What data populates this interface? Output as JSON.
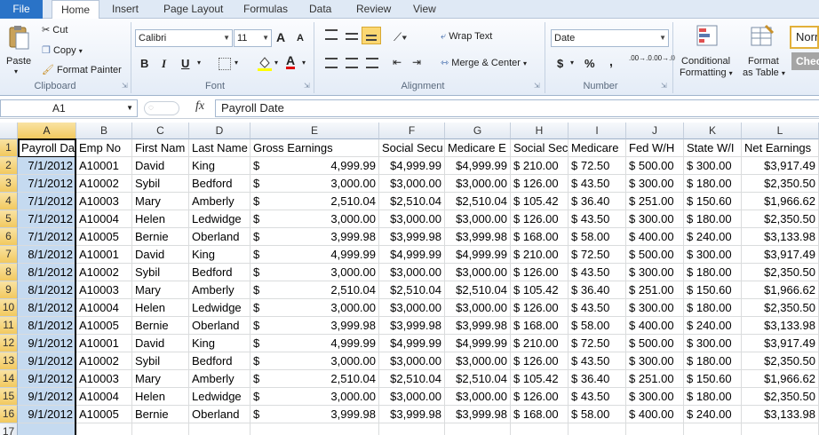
{
  "tabs": {
    "file": "File",
    "items": [
      "Home",
      "Insert",
      "Page Layout",
      "Formulas",
      "Data",
      "Review",
      "View"
    ],
    "active": "Home"
  },
  "clipboard": {
    "paste": "Paste",
    "cut": "Cut",
    "copy": "Copy",
    "format_painter": "Format Painter",
    "label": "Clipboard"
  },
  "font": {
    "name": "Calibri",
    "size": "11",
    "label": "Font",
    "bold": "B",
    "italic": "I",
    "underline": "U",
    "grow": "A",
    "shrink": "A",
    "fill_letter": "",
    "font_color_letter": "A"
  },
  "alignment": {
    "wrap": "Wrap Text",
    "merge": "Merge & Center",
    "label": "Alignment"
  },
  "number": {
    "format": "Date",
    "currency": "$",
    "percent": "%",
    "comma": ",",
    "inc_dec": ".00→.0",
    "dec_dec": ".00→.0",
    "label": "Number"
  },
  "styles": {
    "conditional": "Conditional",
    "conditional2": "Formatting",
    "format_as": "Format",
    "format_as2": "as Table",
    "normal": "Norn",
    "check": "Chec"
  },
  "formula_bar": {
    "name_box": "A1",
    "fx": "fx",
    "content": "Payroll Date"
  },
  "columns": [
    "A",
    "B",
    "C",
    "D",
    "E",
    "F",
    "G",
    "H",
    "I",
    "J",
    "K",
    "L"
  ],
  "selected_column": "A",
  "headers": [
    "Payroll Da",
    "Emp No",
    "First Nam",
    "Last Name",
    "Gross Earnings",
    "Social Secu",
    "Medicare E",
    "Social Sec",
    "Medicare",
    "Fed W/H",
    "State W/I",
    "Net Earnings"
  ],
  "rows": [
    [
      "7/1/2012",
      "A10001",
      "David",
      "King",
      "4,999.99",
      "$4,999.99",
      "$4,999.99",
      "$ 210.00",
      "$  72.50",
      "$ 500.00",
      "$ 300.00",
      "$3,917.49"
    ],
    [
      "7/1/2012",
      "A10002",
      "Sybil",
      "Bedford",
      "3,000.00",
      "$3,000.00",
      "$3,000.00",
      "$ 126.00",
      "$  43.50",
      "$ 300.00",
      "$ 180.00",
      "$2,350.50"
    ],
    [
      "7/1/2012",
      "A10003",
      "Mary",
      "Amberly",
      "2,510.04",
      "$2,510.04",
      "$2,510.04",
      "$ 105.42",
      "$  36.40",
      "$ 251.00",
      "$ 150.60",
      "$1,966.62"
    ],
    [
      "7/1/2012",
      "A10004",
      "Helen",
      "Ledwidge",
      "3,000.00",
      "$3,000.00",
      "$3,000.00",
      "$ 126.00",
      "$  43.50",
      "$ 300.00",
      "$ 180.00",
      "$2,350.50"
    ],
    [
      "7/1/2012",
      "A10005",
      "Bernie",
      "Oberland",
      "3,999.98",
      "$3,999.98",
      "$3,999.98",
      "$ 168.00",
      "$  58.00",
      "$ 400.00",
      "$ 240.00",
      "$3,133.98"
    ],
    [
      "8/1/2012",
      "A10001",
      "David",
      "King",
      "4,999.99",
      "$4,999.99",
      "$4,999.99",
      "$ 210.00",
      "$  72.50",
      "$ 500.00",
      "$ 300.00",
      "$3,917.49"
    ],
    [
      "8/1/2012",
      "A10002",
      "Sybil",
      "Bedford",
      "3,000.00",
      "$3,000.00",
      "$3,000.00",
      "$ 126.00",
      "$  43.50",
      "$ 300.00",
      "$ 180.00",
      "$2,350.50"
    ],
    [
      "8/1/2012",
      "A10003",
      "Mary",
      "Amberly",
      "2,510.04",
      "$2,510.04",
      "$2,510.04",
      "$ 105.42",
      "$  36.40",
      "$ 251.00",
      "$ 150.60",
      "$1,966.62"
    ],
    [
      "8/1/2012",
      "A10004",
      "Helen",
      "Ledwidge",
      "3,000.00",
      "$3,000.00",
      "$3,000.00",
      "$ 126.00",
      "$  43.50",
      "$ 300.00",
      "$ 180.00",
      "$2,350.50"
    ],
    [
      "8/1/2012",
      "A10005",
      "Bernie",
      "Oberland",
      "3,999.98",
      "$3,999.98",
      "$3,999.98",
      "$ 168.00",
      "$  58.00",
      "$ 400.00",
      "$ 240.00",
      "$3,133.98"
    ],
    [
      "9/1/2012",
      "A10001",
      "David",
      "King",
      "4,999.99",
      "$4,999.99",
      "$4,999.99",
      "$ 210.00",
      "$  72.50",
      "$ 500.00",
      "$ 300.00",
      "$3,917.49"
    ],
    [
      "9/1/2012",
      "A10002",
      "Sybil",
      "Bedford",
      "3,000.00",
      "$3,000.00",
      "$3,000.00",
      "$ 126.00",
      "$  43.50",
      "$ 300.00",
      "$ 180.00",
      "$2,350.50"
    ],
    [
      "9/1/2012",
      "A10003",
      "Mary",
      "Amberly",
      "2,510.04",
      "$2,510.04",
      "$2,510.04",
      "$ 105.42",
      "$  36.40",
      "$ 251.00",
      "$ 150.60",
      "$1,966.62"
    ],
    [
      "9/1/2012",
      "A10004",
      "Helen",
      "Ledwidge",
      "3,000.00",
      "$3,000.00",
      "$3,000.00",
      "$ 126.00",
      "$  43.50",
      "$ 300.00",
      "$ 180.00",
      "$2,350.50"
    ],
    [
      "9/1/2012",
      "A10005",
      "Bernie",
      "Oberland",
      "3,999.98",
      "$3,999.98",
      "$3,999.98",
      "$ 168.00",
      "$  58.00",
      "$ 400.00",
      "$ 240.00",
      "$3,133.98"
    ]
  ],
  "gross_currency_symbol": "$",
  "colors": {
    "file_tab": "#2a73c7",
    "selection": "#c5daf0",
    "header_highlight": "#f2c95f"
  }
}
